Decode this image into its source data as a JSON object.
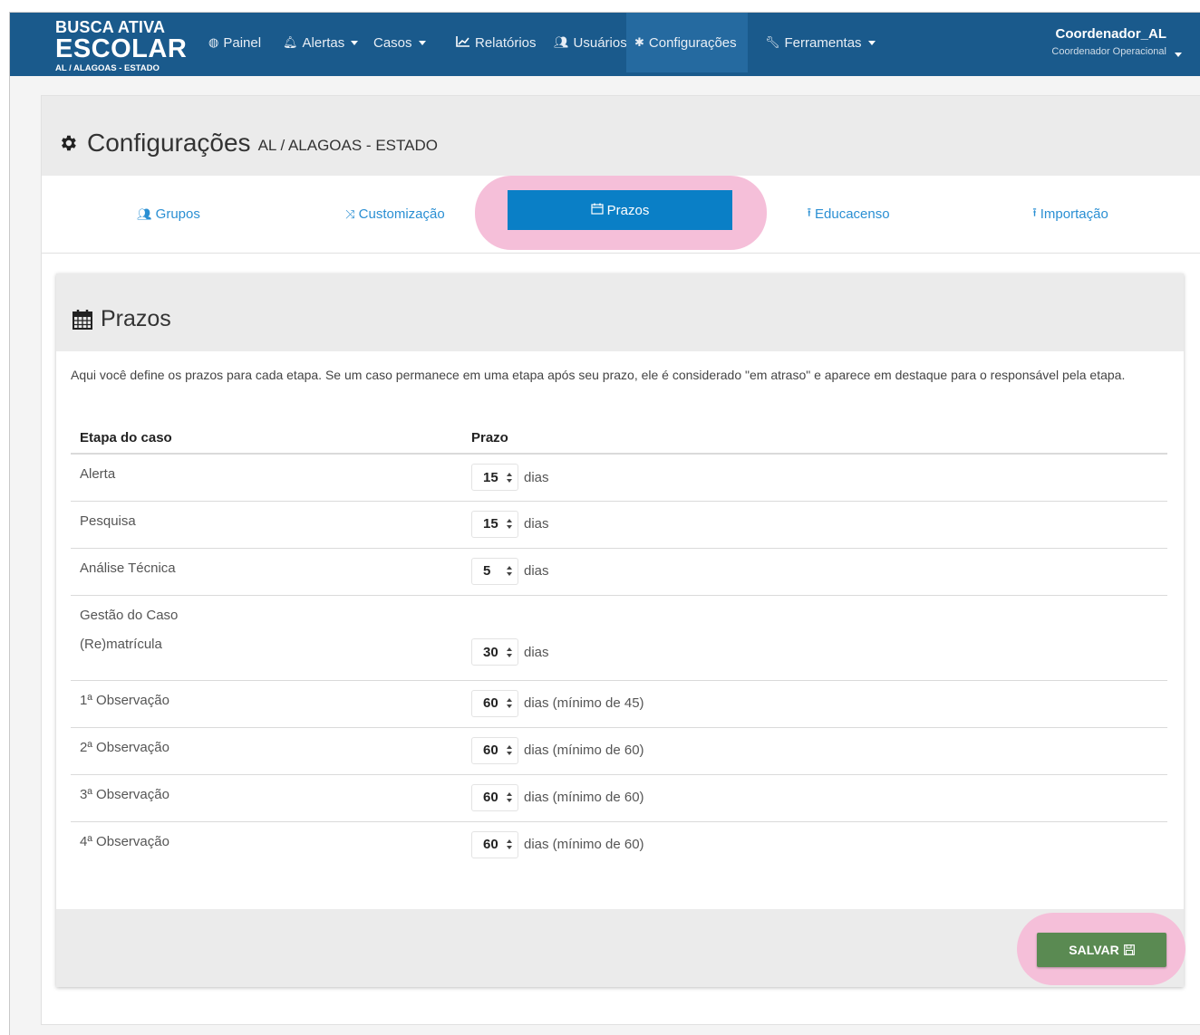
{
  "navbar": {
    "brand_line1": "BUSCA ATIVA",
    "brand_line2": "ESCOLAR",
    "brand_line3": "AL / ALAGOAS - ESTADO",
    "items": [
      {
        "label": "Painel",
        "icon": "dashboard-icon"
      },
      {
        "label": "Alertas",
        "icon": "bell-icon"
      },
      {
        "label": "Casos"
      },
      {
        "label": "Relatórios",
        "icon": "line-chart-icon"
      },
      {
        "label": "Usuários",
        "icon": "users-icon"
      },
      {
        "label": "Configurações",
        "icon": "gear-icon",
        "active": true
      },
      {
        "label": "Ferramentas",
        "icon": "wrench-icon"
      }
    ],
    "user_name": "Coordenador_AL",
    "user_role": "Coordenador Operacional"
  },
  "page": {
    "title": "Configurações",
    "subtitle": "AL / ALAGOAS - ESTADO"
  },
  "tabs": [
    {
      "label": "Grupos",
      "icon": "users-icon"
    },
    {
      "label": "Customização",
      "icon": "shuffle-icon"
    },
    {
      "label": "Prazos",
      "icon": "calendar-icon",
      "active": true
    },
    {
      "label": "Educacenso",
      "icon": "upload-icon"
    },
    {
      "label": "Importação",
      "icon": "upload-icon"
    }
  ],
  "panel": {
    "title": "Prazos",
    "description": "Aqui você define os prazos para cada etapa. Se um caso permanece em uma etapa após seu prazo, ele é considerado \"em atraso\" e aparece em destaque para o responsável pela etapa.",
    "col_stage": "Etapa do caso",
    "col_deadline": "Prazo",
    "rows": [
      {
        "stage": "Alerta",
        "value": "15",
        "unit": "dias"
      },
      {
        "stage": "Pesquisa",
        "value": "15",
        "unit": "dias"
      },
      {
        "stage": "Análise Técnica",
        "value": "5",
        "unit": "dias"
      },
      {
        "stage": "Gestão do Caso"
      },
      {
        "stage": "(Re)matrícula",
        "value": "30",
        "unit": "dias"
      },
      {
        "stage": "1ª Observação",
        "value": "60",
        "unit": "dias (mínimo de 45)"
      },
      {
        "stage": "2ª Observação",
        "value": "60",
        "unit": "dias (mínimo de 60)"
      },
      {
        "stage": "3ª Observação",
        "value": "60",
        "unit": "dias (mínimo de 60)"
      },
      {
        "stage": "4ª Observação",
        "value": "60",
        "unit": "dias (mínimo de 60)"
      }
    ],
    "save_label": "SALVAR"
  },
  "colors": {
    "navbar": "#1a5a8c",
    "active_tab": "#0a7fc6",
    "link": "#2a8fd3",
    "save_button": "#5a8a52",
    "highlight": "#f5bfd9"
  }
}
